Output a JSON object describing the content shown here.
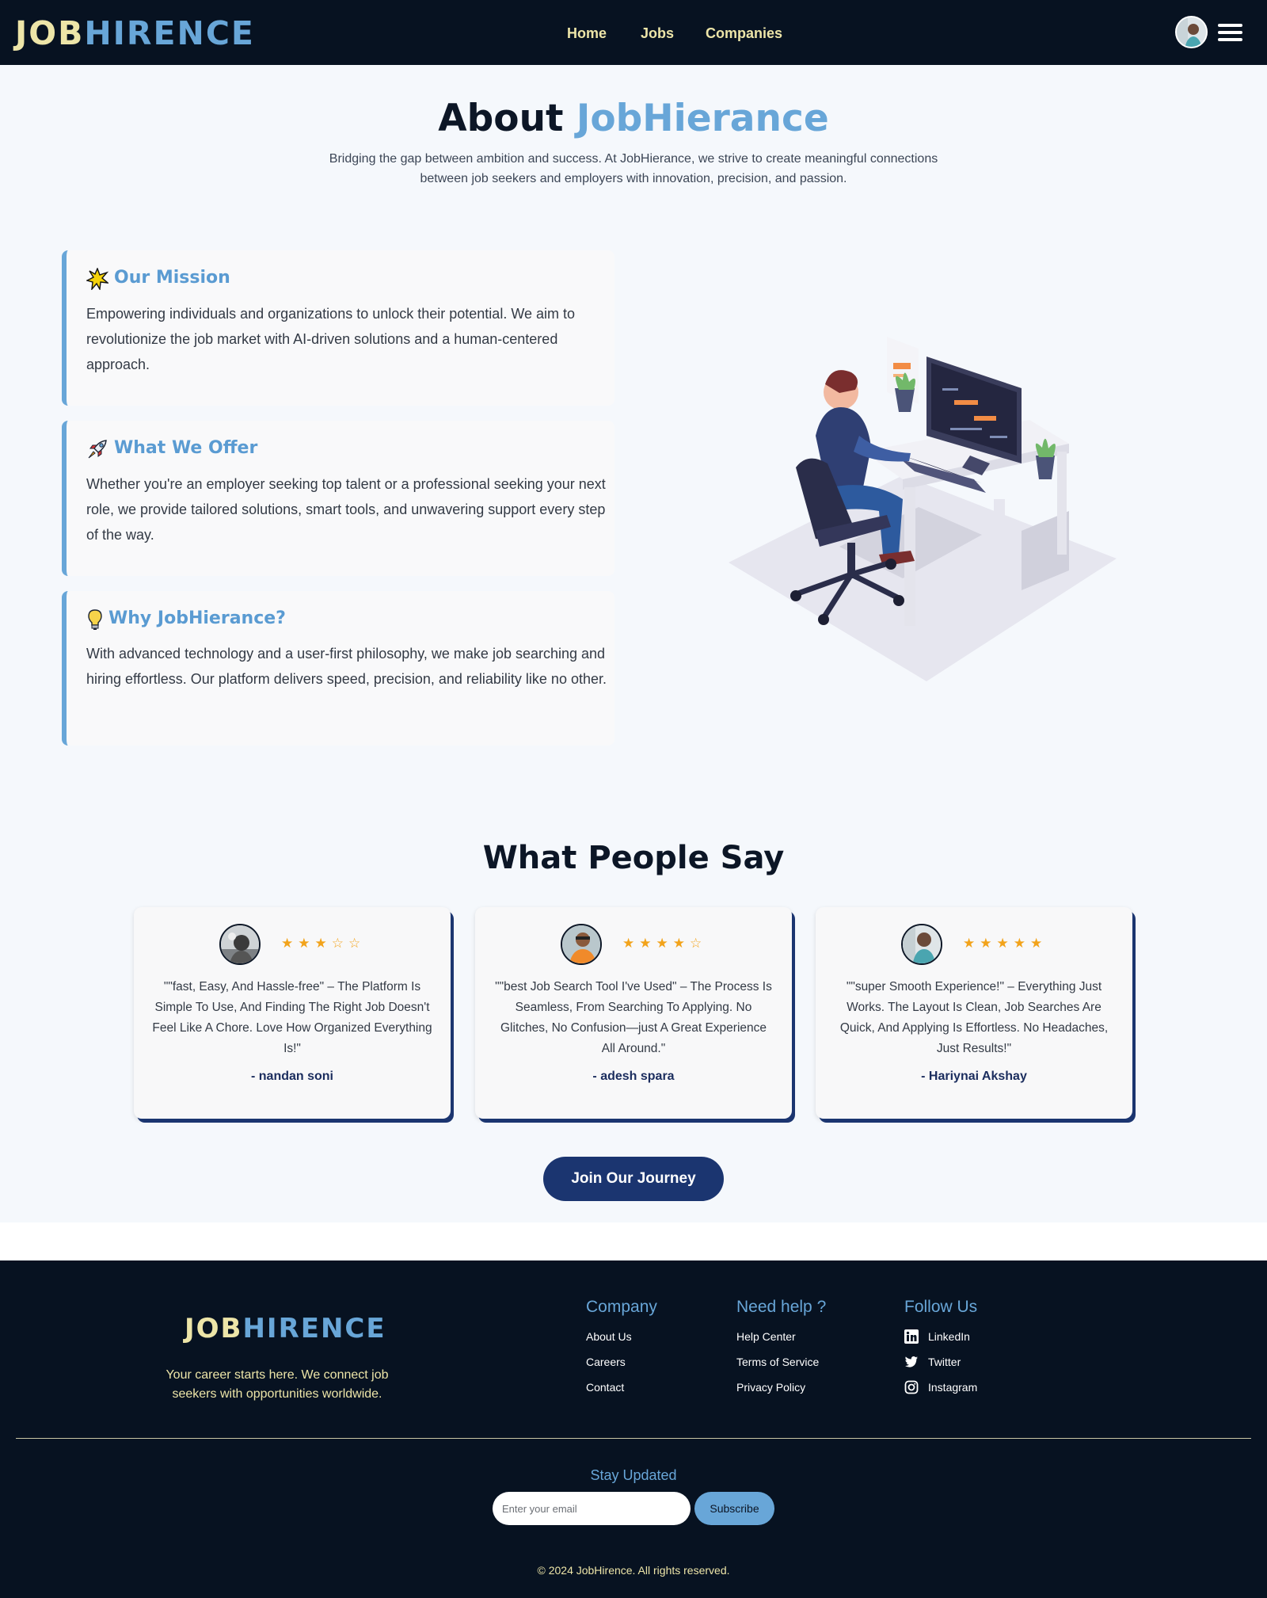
{
  "brand": {
    "part1": "JOB",
    "part2": "HIRENCE"
  },
  "nav": {
    "links": [
      "Home",
      "Jobs",
      "Companies"
    ]
  },
  "about": {
    "title_part1": "About ",
    "title_part2": "JobHierance",
    "subtitle": "Bridging the gap between ambition and success. At JobHierance, we strive to create meaningful connections between job seekers and employers with innovation, precision, and passion."
  },
  "cards": [
    {
      "icon": "sparkle-icon",
      "title": "Our Mission",
      "text": "Empowering individuals and organizations to unlock their potential. We aim to revolutionize the job market with AI-driven solutions and a human-centered approach."
    },
    {
      "icon": "rocket-icon",
      "title": "What We Offer",
      "text": "Whether you're an employer seeking top talent or a professional seeking your next role, we provide tailored solutions, smart tools, and unwavering support every step of the way."
    },
    {
      "icon": "lightbulb-icon",
      "title": "Why JobHierance?",
      "text": "With advanced technology and a user-first philosophy, we make job searching and hiring effortless. Our platform delivers speed, precision, and reliability like no other."
    }
  ],
  "testimonials": {
    "title": "What People Say",
    "items": [
      {
        "stars": "★★★☆☆",
        "rating": 3,
        "quote": "\"\"fast, Easy, And Hassle-free\" – The Platform Is Simple To Use, And Finding The Right Job Doesn't Feel Like A Chore. Love How Organized Everything Is!\"",
        "author": "- nandan soni"
      },
      {
        "stars": "★★★★☆",
        "rating": 4,
        "quote": "\"\"best Job Search Tool I've Used\" – The Process Is Seamless, From Searching To Applying. No Glitches, No Confusion—just A Great Experience All Around.\"",
        "author": "- adesh spara"
      },
      {
        "stars": "★★★★★",
        "rating": 5,
        "quote": "\"\"super Smooth Experience!\" – Everything Just Works. The Layout Is Clean, Job Searches Are Quick, And Applying Is Effortless. No Headaches, Just Results!\"",
        "author": "- Hariynai Akshay"
      }
    ]
  },
  "cta": {
    "join_label": "Join Our Journey"
  },
  "footer": {
    "tagline": "Your career starts here. We connect job seekers with opportunities worldwide.",
    "company": {
      "heading": "Company",
      "links": [
        "About Us",
        "Careers",
        "Contact"
      ]
    },
    "help": {
      "heading": "Need help ?",
      "links": [
        "Help Center",
        "Terms of Service",
        "Privacy Policy"
      ]
    },
    "follow": {
      "heading": "Follow Us",
      "links": [
        {
          "label": "LinkedIn",
          "icon": "linkedin-icon"
        },
        {
          "label": "Twitter",
          "icon": "twitter-icon"
        },
        {
          "label": "Instagram",
          "icon": "instagram-icon"
        }
      ]
    },
    "stay_updated": "Stay Updated",
    "email_placeholder": "Enter your email",
    "subscribe_label": "Subscribe",
    "copyright": "© 2024 JobHirence. All rights reserved."
  },
  "colors": {
    "navy": "#071221",
    "accent_blue": "#68a6d8",
    "cream": "#ede5a8",
    "button_navy": "#1b3570",
    "star": "#f2a31b"
  }
}
